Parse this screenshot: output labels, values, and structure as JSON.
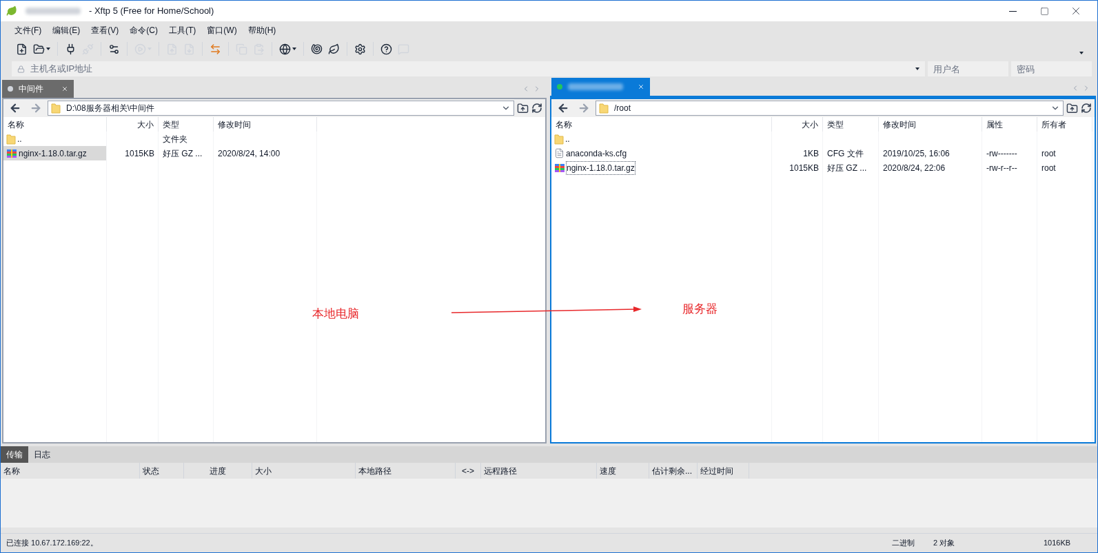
{
  "window": {
    "title": "- Xftp 5 (Free for Home/School)"
  },
  "menu": [
    "文件(F)",
    "编辑(E)",
    "查看(V)",
    "命令(C)",
    "工具(T)",
    "窗口(W)",
    "帮助(H)"
  ],
  "toolbar": [
    {
      "kind": "new",
      "disabled": false,
      "dropdown": false
    },
    {
      "kind": "open",
      "disabled": false,
      "dropdown": true
    },
    {
      "kind": "sep"
    },
    {
      "kind": "connect",
      "disabled": false,
      "dropdown": false
    },
    {
      "kind": "disconnect",
      "disabled": true,
      "dropdown": false
    },
    {
      "kind": "sep"
    },
    {
      "kind": "properties",
      "disabled": false,
      "dropdown": false
    },
    {
      "kind": "sep"
    },
    {
      "kind": "play",
      "disabled": true,
      "dropdown": true
    },
    {
      "kind": "sep"
    },
    {
      "kind": "upload",
      "disabled": true,
      "dropdown": false
    },
    {
      "kind": "download",
      "disabled": true,
      "dropdown": false
    },
    {
      "kind": "sep"
    },
    {
      "kind": "sync",
      "disabled": false,
      "dropdown": false
    },
    {
      "kind": "sep"
    },
    {
      "kind": "copy",
      "disabled": true,
      "dropdown": false
    },
    {
      "kind": "paste",
      "disabled": true,
      "dropdown": false
    },
    {
      "kind": "sep"
    },
    {
      "kind": "globe",
      "disabled": false,
      "dropdown": true
    },
    {
      "kind": "sep"
    },
    {
      "kind": "shell",
      "disabled": false,
      "dropdown": false
    },
    {
      "kind": "leaf",
      "disabled": false,
      "dropdown": false
    },
    {
      "kind": "sep"
    },
    {
      "kind": "settings",
      "disabled": false,
      "dropdown": false
    },
    {
      "kind": "sep"
    },
    {
      "kind": "help",
      "disabled": false,
      "dropdown": false
    },
    {
      "kind": "chat",
      "disabled": true,
      "dropdown": false
    }
  ],
  "address_bar": {
    "host_placeholder": "主机名或IP地址",
    "user_placeholder": "用户名",
    "password_placeholder": "密码"
  },
  "panes": [
    {
      "tab": {
        "label": "中间件",
        "selected": false,
        "connected": false
      },
      "path": "D:\\08服务器相关\\中间件",
      "columns": [
        "名称",
        "大小",
        "类型",
        "修改时间"
      ],
      "rows": [
        {
          "kind": "folder",
          "cells": [
            "..",
            "",
            "文件夹",
            ""
          ],
          "selected": false,
          "focused": false
        },
        {
          "kind": "archive",
          "cells": [
            "nginx-1.18.0.tar.gz",
            "1015KB",
            "好压 GZ ...",
            "2020/8/24, 14:00"
          ],
          "selected": true,
          "focused": false
        }
      ],
      "annotation": "本地电脑"
    },
    {
      "tab": {
        "selected": true,
        "connected": true
      },
      "path": "/root",
      "columns": [
        "名称",
        "大小",
        "类型",
        "修改时间",
        "属性",
        "所有者"
      ],
      "rows": [
        {
          "kind": "folder",
          "cells": [
            "..",
            "",
            "",
            "",
            "",
            ""
          ],
          "selected": false,
          "focused": false
        },
        {
          "kind": "file",
          "cells": [
            "anaconda-ks.cfg",
            "1KB",
            "CFG 文件",
            "2019/10/25, 16:06",
            "-rw-------",
            "root"
          ],
          "selected": false,
          "focused": false
        },
        {
          "kind": "archive",
          "cells": [
            "nginx-1.18.0.tar.gz",
            "1015KB",
            "好压 GZ ...",
            "2020/8/24, 22:06",
            "-rw-r--r--",
            "root"
          ],
          "selected": false,
          "focused": true
        }
      ],
      "annotation": "服务器"
    }
  ],
  "bottom_tabs": [
    {
      "label": "传输",
      "selected": true
    },
    {
      "label": "日志",
      "selected": false
    }
  ],
  "transfer_columns": [
    "名称",
    "状态",
    "进度",
    "大小",
    "本地路径",
    "<->",
    "远程路径",
    "速度",
    "估计剩余...",
    "经过时间"
  ],
  "status_bar": {
    "message": "已连接 10.67.172.169:22。",
    "mode": "二进制",
    "objects": "2 对象",
    "size": "1016KB"
  }
}
